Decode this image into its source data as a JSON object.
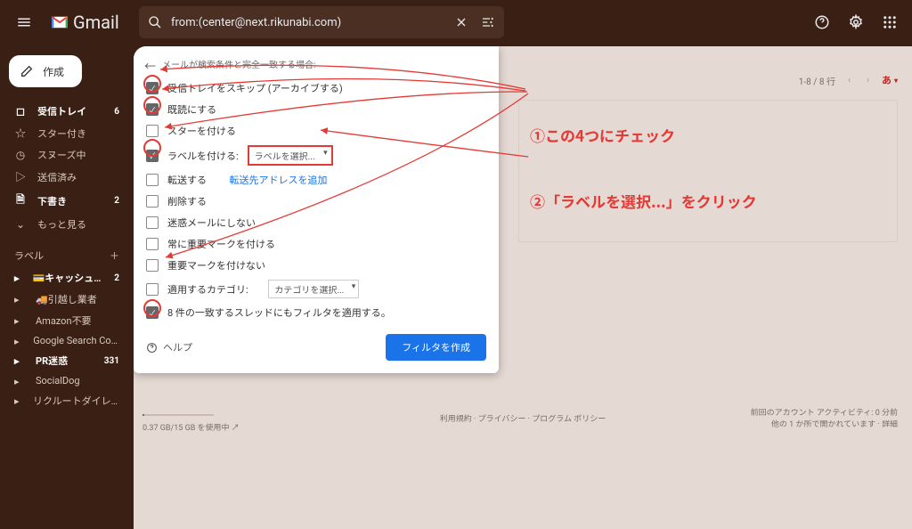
{
  "search": {
    "value": "from:(center@next.rikunabi.com)"
  },
  "logo": "Gmail",
  "compose": {
    "label": "作成"
  },
  "nav": [
    {
      "icon": "☐",
      "label": "受信トレイ",
      "count": "6",
      "bold": true
    },
    {
      "icon": "☆",
      "label": "スター付き",
      "count": ""
    },
    {
      "icon": "⏱",
      "label": "スヌーズ中",
      "count": ""
    },
    {
      "icon": "▷",
      "label": "送信済み",
      "count": ""
    },
    {
      "icon": "🗎",
      "label": "下書き",
      "count": "2",
      "bold": true
    },
    {
      "icon": "⌄",
      "label": "もっと見る",
      "count": ""
    }
  ],
  "labels_section": "ラベル",
  "labels": [
    {
      "icon": "📁",
      "text": "💳キャッシュカード...",
      "count": "2",
      "bold": true
    },
    {
      "icon": "📁",
      "text": "🚚引越し業者",
      "count": ""
    },
    {
      "icon": "📁",
      "text": "Amazon不要",
      "count": ""
    },
    {
      "icon": "📁",
      "text": "Google Search Console ...",
      "count": ""
    },
    {
      "icon": "📁",
      "text": "PR迷惑",
      "count": "331",
      "bold": true
    },
    {
      "icon": "📁",
      "text": "SocialDog",
      "count": ""
    },
    {
      "icon": "📁",
      "text": "リクルートダイレクトス...",
      "count": ""
    }
  ],
  "pagination": "1-8 / 8 行",
  "lang_indicator": "あ",
  "filter": {
    "header": "メールが検索条件と完全一致する場合:",
    "options": {
      "skip_inbox": "受信トレイをスキップ (アーカイブする)",
      "mark_read": "既読にする",
      "star": "スターを付ける",
      "apply_label": "ラベルを付ける:",
      "label_select": "ラベルを選択...",
      "forward": "転送する",
      "forward_link": "転送先アドレスを追加",
      "delete": "削除する",
      "never_spam": "迷惑メールにしない",
      "always_important": "常に重要マークを付ける",
      "never_important": "重要マークを付けない",
      "category": "適用するカテゴリ:",
      "category_select": "カテゴリを選択...",
      "apply_existing": "8 件の一致するスレッドにもフィルタを適用する。"
    },
    "help": "ヘルプ",
    "create_button": "フィルタを作成"
  },
  "annotations": {
    "one": "①この4つにチェック",
    "two": "②「ラベルを選択...」をクリック"
  },
  "footer": {
    "storage": "0.37 GB/15 GB を使用中",
    "links": "利用規約 · プライバシー · プログラム ポリシー",
    "activity1": "前回のアカウント アクティビティ: 0 分前",
    "activity2": "他の 1 か所で開かれています · 詳細"
  }
}
